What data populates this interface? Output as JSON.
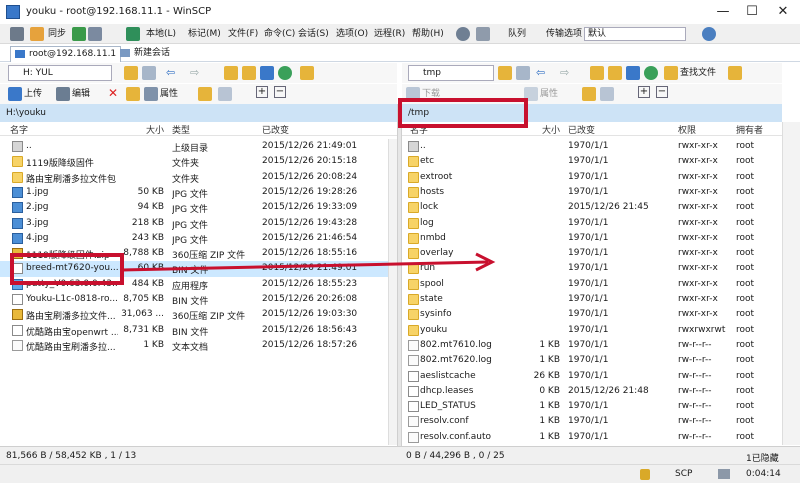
{
  "window": {
    "title": "youku - root@192.168.11.1 - WinSCP"
  },
  "menu": [
    "本地(L)",
    "标记(M)",
    "文件(F)",
    "命令(C)",
    "会话(S)",
    "选项(O)",
    "远程(R)",
    "帮助(H)"
  ],
  "toolbar": {
    "sync_label": "同步",
    "queue_label": "队列",
    "transfer_options_label": "传输选项",
    "transfer_preset_value": "默认"
  },
  "session_tabs": {
    "active": "root@192.168.11.1",
    "new_session": "新建会话"
  },
  "local": {
    "drive": "H: YUL",
    "upload_label": "上传",
    "edit_label": "编辑",
    "properties_label": "属性",
    "path": "H:\\youku",
    "columns": [
      "名字",
      "大小",
      "类型",
      "已改变"
    ],
    "files": [
      {
        "name": "..",
        "size": "",
        "type": "上级目录",
        "changed": "2015/12/26  21:49:01",
        "icon": "parent"
      },
      {
        "name": "1119版降级固件",
        "size": "",
        "type": "文件夹",
        "changed": "2015/12/26  20:15:18",
        "icon": "folder"
      },
      {
        "name": "路由宝刷潘多拉文件包",
        "size": "",
        "type": "文件夹",
        "changed": "2015/12/26  20:08:24",
        "icon": "folder"
      },
      {
        "name": "1.jpg",
        "size": "50 KB",
        "type": "JPG 文件",
        "changed": "2015/12/26  19:28:26",
        "icon": "jpg"
      },
      {
        "name": "2.jpg",
        "size": "94 KB",
        "type": "JPG 文件",
        "changed": "2015/12/26  19:33:09",
        "icon": "jpg"
      },
      {
        "name": "3.jpg",
        "size": "218 KB",
        "type": "JPG 文件",
        "changed": "2015/12/26  19:43:28",
        "icon": "jpg"
      },
      {
        "name": "4.jpg",
        "size": "243 KB",
        "type": "JPG 文件",
        "changed": "2015/12/26  21:46:54",
        "icon": "jpg"
      },
      {
        "name": "1119版降级固件.zip",
        "size": "8,788 KB",
        "type": "360压缩 ZIP 文件",
        "changed": "2015/12/26  18:55:16",
        "icon": "zip"
      },
      {
        "name": "breed-mt7620-you...",
        "size": "60 KB",
        "type": "BIN 文件",
        "changed": "2015/12/26  21:49:01",
        "icon": "bin"
      },
      {
        "name": "putty_V0.63.0.0.43...",
        "size": "484 KB",
        "type": "应用程序",
        "changed": "2015/12/26  18:55:23",
        "icon": "app"
      },
      {
        "name": "Youku-L1c-0818-ro...",
        "size": "8,705 KB",
        "type": "BIN 文件",
        "changed": "2015/12/26  20:26:08",
        "icon": "bin"
      },
      {
        "name": "路由宝刷潘多拉文件...",
        "size": "31,063 ...",
        "type": "360压缩 ZIP 文件",
        "changed": "2015/12/26  19:03:30",
        "icon": "zip"
      },
      {
        "name": "优酷路由宝openwrt ...",
        "size": "8,731 KB",
        "type": "BIN 文件",
        "changed": "2015/12/26  18:56:43",
        "icon": "bin"
      },
      {
        "name": "优酷路由宝刷潘多拉...",
        "size": "1 KB",
        "type": "文本文档",
        "changed": "2015/12/26  18:57:26",
        "icon": "txt"
      }
    ],
    "status": "81,566 B / 58,452 KB , 1 / 13"
  },
  "remote": {
    "drive": "tmp",
    "download_label": "下载",
    "properties_label": "属性",
    "find_files_label": "查找文件",
    "path": "/tmp",
    "columns": [
      "名字",
      "大小",
      "已改变",
      "权限",
      "拥有者"
    ],
    "files": [
      {
        "name": "..",
        "size": "",
        "changed": "1970/1/1",
        "rights": "rwxr-xr-x",
        "owner": "root",
        "icon": "parent"
      },
      {
        "name": "etc",
        "size": "",
        "changed": "1970/1/1",
        "rights": "rwxr-xr-x",
        "owner": "root",
        "icon": "folder"
      },
      {
        "name": "extroot",
        "size": "",
        "changed": "1970/1/1",
        "rights": "rwxr-xr-x",
        "owner": "root",
        "icon": "folder"
      },
      {
        "name": "hosts",
        "size": "",
        "changed": "1970/1/1",
        "rights": "rwxr-xr-x",
        "owner": "root",
        "icon": "folder"
      },
      {
        "name": "lock",
        "size": "",
        "changed": "2015/12/26 21:45",
        "rights": "rwxr-xr-x",
        "owner": "root",
        "icon": "folder"
      },
      {
        "name": "log",
        "size": "",
        "changed": "1970/1/1",
        "rights": "rwxr-xr-x",
        "owner": "root",
        "icon": "folder"
      },
      {
        "name": "nmbd",
        "size": "",
        "changed": "1970/1/1",
        "rights": "rwxr-xr-x",
        "owner": "root",
        "icon": "folder"
      },
      {
        "name": "overlay",
        "size": "",
        "changed": "1970/1/1",
        "rights": "rwxr-xr-x",
        "owner": "root",
        "icon": "folder"
      },
      {
        "name": "run",
        "size": "",
        "changed": "1970/1/1",
        "rights": "rwxr-xr-x",
        "owner": "root",
        "icon": "folder"
      },
      {
        "name": "spool",
        "size": "",
        "changed": "1970/1/1",
        "rights": "rwxr-xr-x",
        "owner": "root",
        "icon": "folder"
      },
      {
        "name": "state",
        "size": "",
        "changed": "1970/1/1",
        "rights": "rwxr-xr-x",
        "owner": "root",
        "icon": "folder"
      },
      {
        "name": "sysinfo",
        "size": "",
        "changed": "1970/1/1",
        "rights": "rwxr-xr-x",
        "owner": "root",
        "icon": "folder"
      },
      {
        "name": "youku",
        "size": "",
        "changed": "1970/1/1",
        "rights": "rwxrwxrwt",
        "owner": "root",
        "icon": "folder"
      },
      {
        "name": "802.mt7610.log",
        "size": "1 KB",
        "changed": "1970/1/1",
        "rights": "rw-r--r--",
        "owner": "root",
        "icon": "txt"
      },
      {
        "name": "802.mt7620.log",
        "size": "1 KB",
        "changed": "1970/1/1",
        "rights": "rw-r--r--",
        "owner": "root",
        "icon": "txt"
      },
      {
        "name": "aeslistcache",
        "size": "26 KB",
        "changed": "1970/1/1",
        "rights": "rw-r--r--",
        "owner": "root",
        "icon": "bin"
      },
      {
        "name": "dhcp.leases",
        "size": "0 KB",
        "changed": "2015/12/26 21:48",
        "rights": "rw-r--r--",
        "owner": "root",
        "icon": "bin"
      },
      {
        "name": "LED_STATUS",
        "size": "1 KB",
        "changed": "1970/1/1",
        "rights": "rw-r--r--",
        "owner": "root",
        "icon": "bin"
      },
      {
        "name": "resolv.conf",
        "size": "1 KB",
        "changed": "1970/1/1",
        "rights": "rw-r--r--",
        "owner": "root",
        "icon": "txt"
      },
      {
        "name": "resolv.conf.auto",
        "size": "1 KB",
        "changed": "1970/1/1",
        "rights": "rw-r--r--",
        "owner": "root",
        "icon": "txt"
      }
    ],
    "status": "0 B / 44,296 B , 0 / 25",
    "hidden_count": "1已隐藏"
  },
  "statusbar": {
    "protocol": "SCP",
    "elapsed": "0:04:14"
  },
  "colors": {
    "highlight": "#c8102e",
    "path_bg": "#cde3f6"
  }
}
